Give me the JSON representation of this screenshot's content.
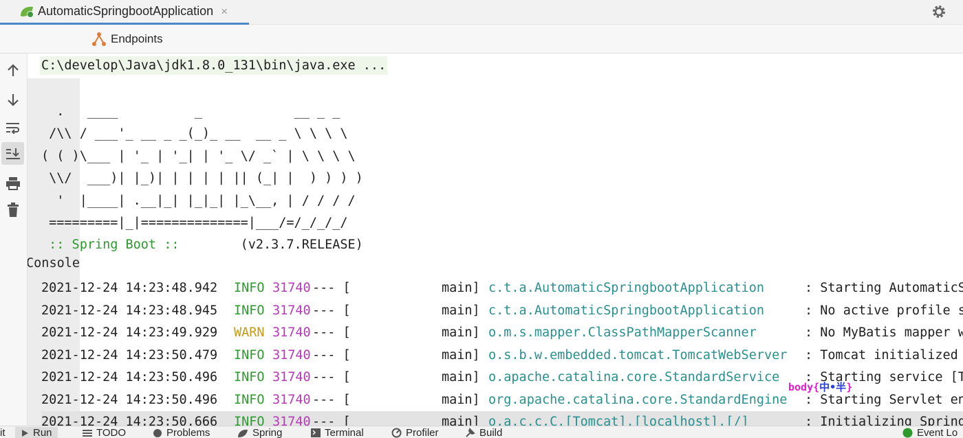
{
  "run_tab": {
    "title": "AutomaticSpringbootApplication",
    "close": "×"
  },
  "subtabs": {
    "console": "Console",
    "endpoints": "Endpoints"
  },
  "toolstrip": [
    "up-arrow-icon",
    "down-arrow-icon",
    "soft-wrap-icon",
    "scroll-to-end-icon",
    "print-icon",
    "trash-icon"
  ],
  "console": {
    "command": "C:\\develop\\Java\\jdk1.8.0_131\\bin\\java.exe ...",
    "banner": [
      "  .   ____          _            __ _ _",
      " /\\\\ / ___'_ __ _ _(_)_ __  __ _ \\ \\ \\ \\",
      "( ( )\\___ | '_ | '_| | '_ \\/ _` | \\ \\ \\ \\",
      " \\\\/  ___)| |_)| | | | | || (_| |  ) ) ) )",
      "  '  |____| .__|_| |_|_| |_\\__, | / / / /",
      " =========|_|==============|___/=/_/_/_/"
    ],
    "spring_boot_label": " :: Spring Boot :: ",
    "spring_boot_version": "       (v2.3.7.RELEASE)",
    "logs": [
      {
        "date": "2021-12-24 14:23:48.942",
        "level": "INFO",
        "pid": "31740",
        "sep": "--- [",
        "thread": "main]",
        "logger": "c.t.a.AutomaticSpringbootApplication",
        "msg": ": Starting AutomaticS"
      },
      {
        "date": "2021-12-24 14:23:48.945",
        "level": "INFO",
        "pid": "31740",
        "sep": "--- [",
        "thread": "main]",
        "logger": "c.t.a.AutomaticSpringbootApplication",
        "msg": ": No active profile s"
      },
      {
        "date": "2021-12-24 14:23:49.929",
        "level": "WARN",
        "pid": "31740",
        "sep": "--- [",
        "thread": "main]",
        "logger": "o.m.s.mapper.ClassPathMapperScanner",
        "msg": ": No MyBatis mapper w"
      },
      {
        "date": "2021-12-24 14:23:50.479",
        "level": "INFO",
        "pid": "31740",
        "sep": "--- [",
        "thread": "main]",
        "logger": "o.s.b.w.embedded.tomcat.TomcatWebServer",
        "msg": ": Tomcat initialized "
      },
      {
        "date": "2021-12-24 14:23:50.496",
        "level": "INFO",
        "pid": "31740",
        "sep": "--- [",
        "thread": "main]",
        "logger": "o.apache.catalina.core.StandardService",
        "msg": ": Starting service [T"
      },
      {
        "date": "2021-12-24 14:23:50.496",
        "level": "INFO",
        "pid": "31740",
        "sep": "--- [",
        "thread": "main]",
        "logger": "org.apache.catalina.core.StandardEngine",
        "msg": ": Starting Servlet en"
      },
      {
        "date": "2021-12-24 14:23:50.666",
        "level": "INFO",
        "pid": "31740",
        "sep": "--- [",
        "thread": "main]",
        "logger": "o.a.c.c.C.[Tomcat].[localhost].[/]",
        "msg": ": Initializing Spring"
      }
    ]
  },
  "overlay": {
    "prefix": "body{",
    "inner": "中•半",
    "suffix": "}"
  },
  "bottombar": {
    "left_cut": "it",
    "run": "Run",
    "todo": "TODO",
    "problems": "Problems",
    "spring": "Spring",
    "terminal": "Terminal",
    "profiler": "Profiler",
    "build": "Build",
    "event_log": "Event Lo"
  }
}
